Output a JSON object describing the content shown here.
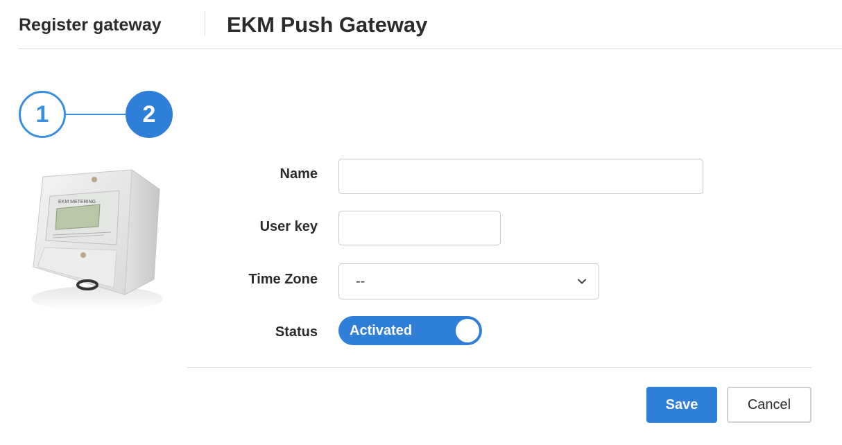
{
  "header": {
    "section_title": "Register gateway",
    "page_title": "EKM Push Gateway"
  },
  "stepper": {
    "steps": [
      {
        "number": "1",
        "state": "complete"
      },
      {
        "number": "2",
        "state": "active"
      }
    ]
  },
  "form": {
    "name": {
      "label": "Name",
      "value": ""
    },
    "user_key": {
      "label": "User key",
      "value": ""
    },
    "time_zone": {
      "label": "Time Zone",
      "value": "--"
    },
    "status": {
      "label": "Status",
      "value": "Activated",
      "on": true
    }
  },
  "actions": {
    "save_label": "Save",
    "cancel_label": "Cancel"
  },
  "colors": {
    "accent": "#2f7fd8",
    "step_outline": "#3a8ee0"
  },
  "icons": {
    "select_arrow": "chevron-down-icon",
    "device": "ekm-meter-image"
  }
}
